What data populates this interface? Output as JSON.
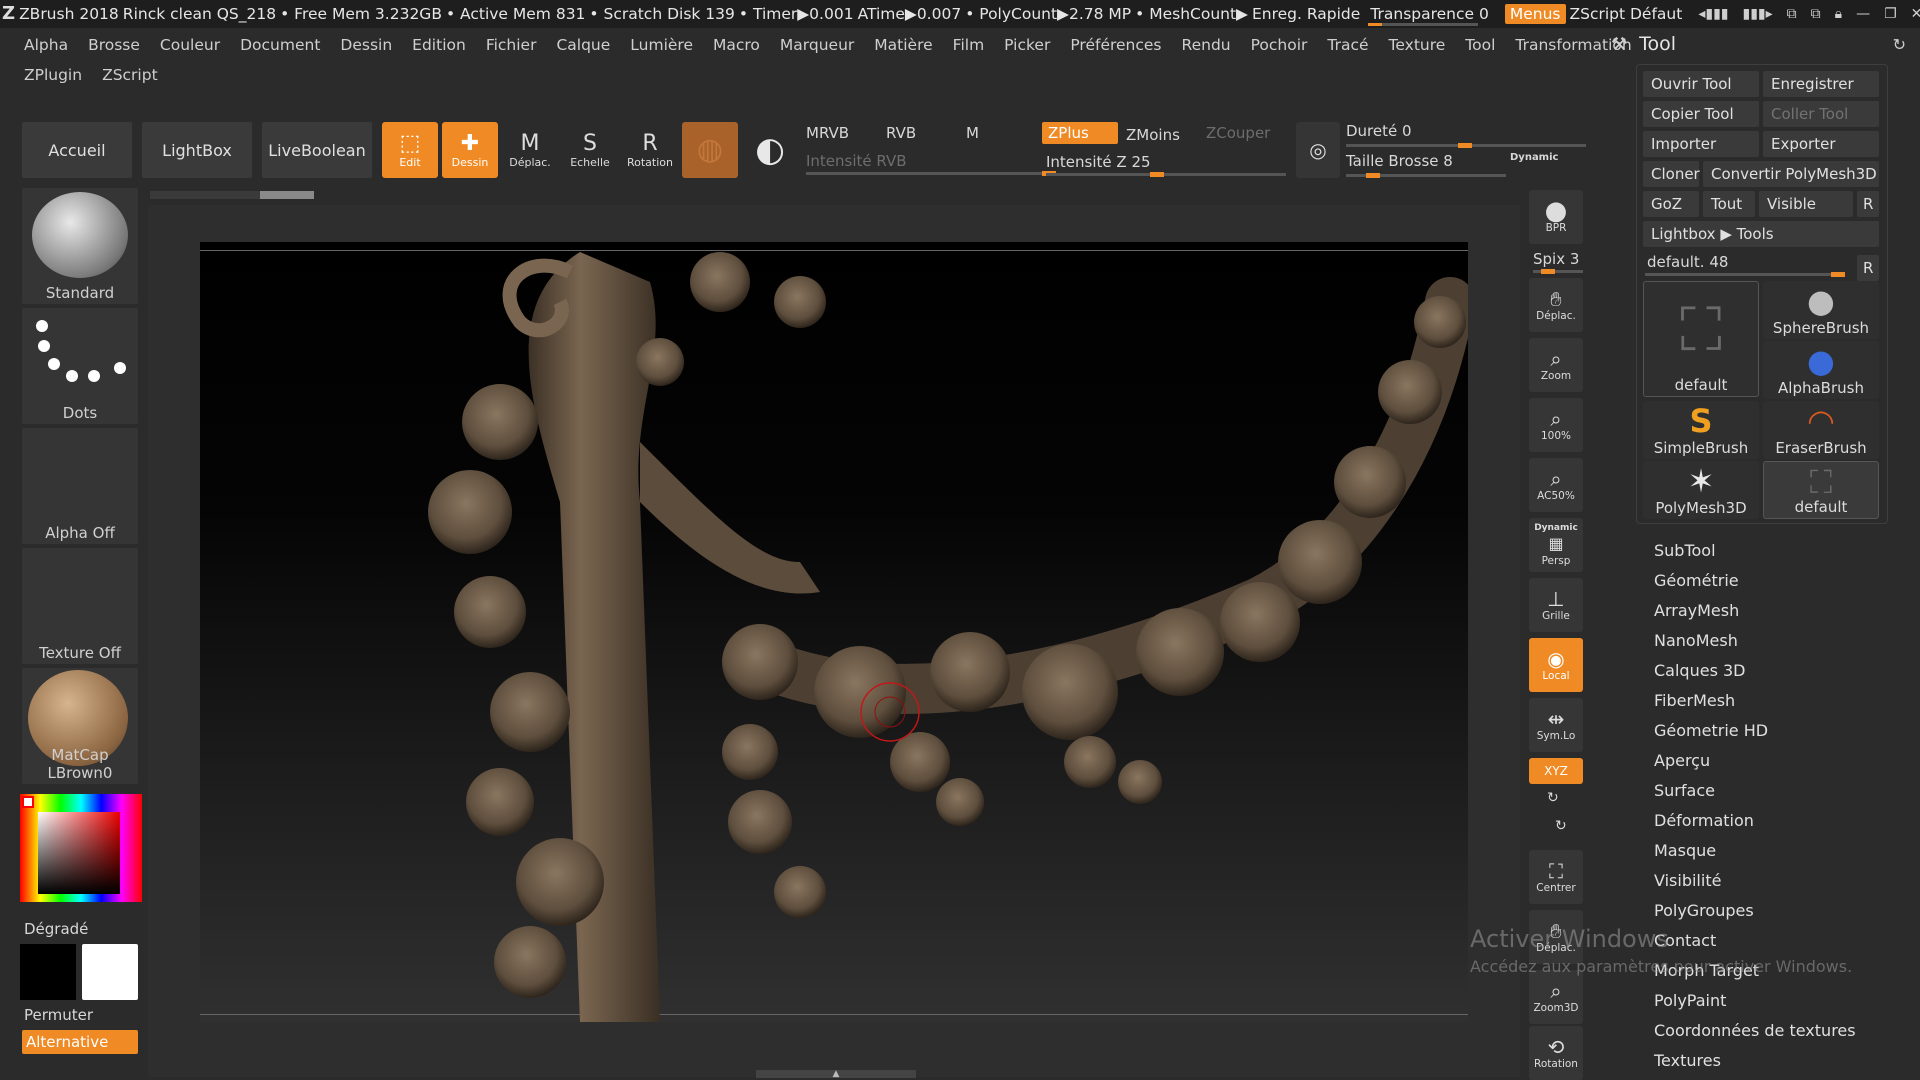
{
  "titlebar": {
    "app": "ZBrush 2018",
    "doc": "Rinck clean QS_218",
    "free_mem": "• Free Mem 3.232GB",
    "active_mem": "• Active Mem 831",
    "scratch": "• Scratch Disk 139",
    "timer": "• Timer▶0.001",
    "atime": "ATime▶0.007",
    "polycount": "• PolyCount▶2.78 MP",
    "meshcount": "• MeshCount▶",
    "quicksave": "Enreg. Rapide",
    "transparence": "Transparence 0",
    "menus": "Menus",
    "zscript": "ZScript Défaut"
  },
  "menus": {
    "row1": [
      "Alpha",
      "Brosse",
      "Couleur",
      "Document",
      "Dessin",
      "Edition",
      "Fichier",
      "Calque",
      "Lumière",
      "Macro",
      "Marqueur",
      "Matière",
      "Film",
      "Picker",
      "Préférences",
      "Rendu",
      "Pochoir",
      "Tracé",
      "Texture",
      "Tool",
      "Transformation"
    ],
    "row2": [
      "ZPlugin",
      "ZScript"
    ]
  },
  "shelf": {
    "accueil": "Accueil",
    "lightbox": "LightBox",
    "liveboolean": "LiveBoolean",
    "edit": "Edit",
    "dessin": "Dessin",
    "deplac": "Déplac.",
    "echelle": "Echelle",
    "rotation": "Rotation",
    "mrvb": "MRVB",
    "rvb": "RVB",
    "m": "M",
    "intensite_rvb": "Intensité RVB",
    "zplus": "ZPlus",
    "zmoins": "ZMoins",
    "zcouper": "ZCouper",
    "intensite_z": "Intensité Z 25",
    "durete": "Dureté 0",
    "taille_brosse": "Taille Brosse 8",
    "dynamic": "Dynamic"
  },
  "left_palette": {
    "brush": "Standard",
    "stroke": "Dots",
    "alpha": "Alpha Off",
    "texture": "Texture Off",
    "material": "MatCap LBrown0",
    "gradient": "Dégradé",
    "permuter": "Permuter",
    "alternative": "Alternative"
  },
  "right_column": {
    "bpr": "BPR",
    "spix": "Spix 3",
    "deplac": "Déplac.",
    "zoom": "Zoom",
    "actual": "100%",
    "ac50": "AC50%",
    "persp_top": "Dynamic",
    "persp": "Persp",
    "grille": "Grille",
    "local": "Local",
    "symlo": "Sym.Lo",
    "xyz": "XYZ",
    "centrer": "Centrer",
    "deplac2": "Déplac.",
    "zoom3d": "Zoom3D",
    "rotation": "Rotation"
  },
  "tool_palette": {
    "title": "Tool",
    "open": "Ouvrir Tool",
    "save": "Enregistrer",
    "copy": "Copier Tool",
    "paste": "Coller Tool",
    "import": "Importer",
    "export": "Exporter",
    "clone": "Cloner",
    "convert": "Convertir PolyMesh3D",
    "goz": "GoZ",
    "tout": "Tout",
    "visible": "Visible",
    "r": "R",
    "lightbox_tools": "Lightbox ▶ Tools",
    "default_slider": "default. 48",
    "thumbs": [
      "default",
      "SphereBrush",
      "AlphaBrush",
      "SimpleBrush",
      "EraserBrush",
      "PolyMesh3D",
      "default"
    ]
  },
  "sections": [
    "SubTool",
    "Géométrie",
    "ArrayMesh",
    "NanoMesh",
    "Calques 3D",
    "FiberMesh",
    "Géometrie HD",
    "Aperçu",
    "Surface",
    "Déformation",
    "Masque",
    "Visibilité",
    "PolyGroupes",
    "Contact",
    "Morph Target",
    "PolyPaint",
    "Coordonnées de textures",
    "Textures"
  ],
  "watermark": {
    "line1": "Activer Windows",
    "line2": "Accédez aux paramètres pour activer Windows."
  },
  "colors": {
    "accent": "#f08a24",
    "panel": "#2b2b2b",
    "clay": "#6b5a47"
  }
}
